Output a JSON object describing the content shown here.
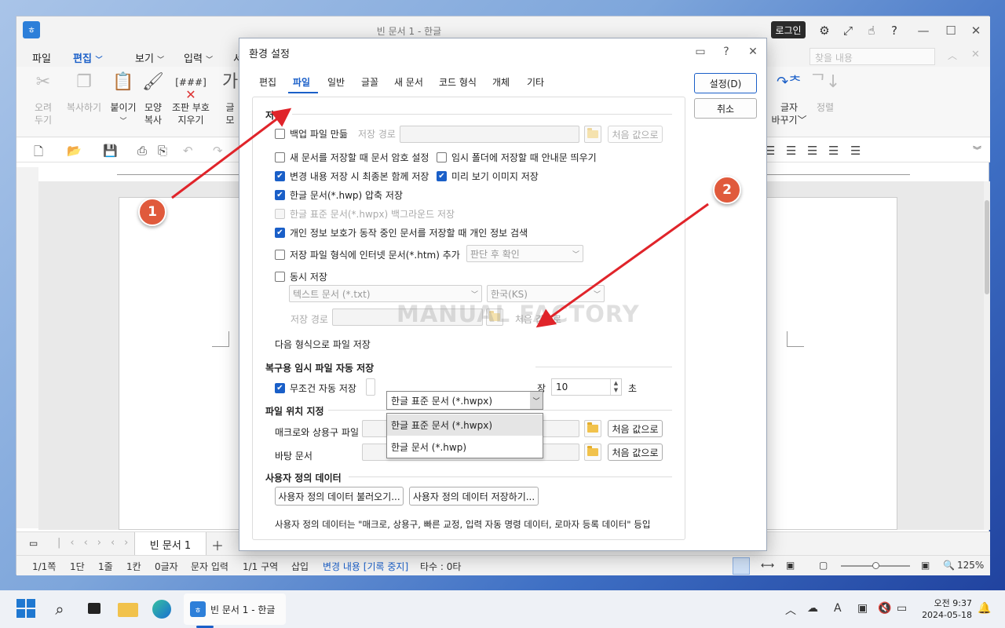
{
  "app": {
    "title": "빈 문서 1 - 한글",
    "login": "로그인",
    "icons": [
      "gear-icon",
      "expand-icon",
      "hand-icon",
      "help-icon"
    ],
    "window_controls": [
      "minimize-icon",
      "maximize-icon",
      "close-icon"
    ]
  },
  "menu": {
    "items": [
      "파일",
      "편집",
      "보기",
      "입력",
      "서"
    ],
    "active": "편집",
    "search_placeholder": "찾을 내용"
  },
  "ribbon": {
    "items": [
      {
        "label": "오려\n두기",
        "disabled": true
      },
      {
        "label": "복사하기",
        "disabled": true
      },
      {
        "label": "붙이기",
        "disabled": false
      },
      {
        "label": "모양\n복사",
        "disabled": false
      },
      {
        "label": "조판 부호\n지우기",
        "disabled": false
      },
      {
        "label": "글\n모",
        "disabled": false
      }
    ],
    "right_items": [
      {
        "label": "글자\n바꾸기",
        "disabled": false
      },
      {
        "label": "정렬",
        "disabled": true
      }
    ]
  },
  "document": {
    "tab": "빈 문서 1"
  },
  "status": {
    "items": [
      "1/1쪽",
      "1단",
      "1줄",
      "1칸",
      "0글자",
      "문자 입력",
      "1/1 구역",
      "삽입"
    ],
    "change_tracking": "변경 내용 [기록 중지]",
    "typing": "타수 : 0타",
    "zoom": "125%"
  },
  "dialog": {
    "title": "환경 설정",
    "tabs": [
      "편집",
      "파일",
      "일반",
      "글꼴",
      "새 문서",
      "코드 형식",
      "개체",
      "기타"
    ],
    "active_tab": "파일",
    "ok": "설정(D)",
    "cancel": "취소",
    "section_save": "저장",
    "backup": "백업 파일 만듦",
    "save_path_label": "저장 경로",
    "reset": "처음 값으로",
    "password_new": "새 문서를 저장할 때 문서 암호 설정",
    "temp_folder_notice": "임시 폴더에 저장할 때 안내문 띄우기",
    "keep_latest": "변경 내용 저장 시 최종본 함께 저장",
    "preview_image": "미리 보기 이미지 저장",
    "compress_hwp": "한글 문서(*.hwp) 압축 저장",
    "hwpx_background": "한글 표준 문서(*.hwpx) 백그라운드 저장",
    "privacy_search": "개인 정보 보호가 동작 중인 문서를 저장할 때 개인 정보 검색",
    "add_htm": "저장 파일 형식에 인터넷 문서(*.htm) 추가",
    "add_htm_option": "판단 후 확인",
    "simultaneous": "동시 저장",
    "simul_format": "텍스트 문서 (*.txt)",
    "simul_encoding": "한국(KS)",
    "simul_reset_partial": "처음 값으로",
    "save_as_label": "다음 형식으로 파일 저장",
    "save_as_value": "한글 표준 문서 (*.hwpx)",
    "save_as_options": [
      "한글 표준 문서 (*.hwpx)",
      "한글 문서 (*.hwp)"
    ],
    "section_autosave": "복구용 임시 파일 자동 저장",
    "autosave_always": "무조건 자동 저장",
    "autosave_partial_label": "장",
    "autosave_seconds": "10",
    "autosave_unit": "초",
    "section_location": "파일 위치 지정",
    "macro_label": "매크로와 상용구 파일",
    "background_label": "바탕 문서",
    "section_user": "사용자 정의 데이터",
    "load_user": "사용자 정의 데이터 불러오기...",
    "save_user": "사용자 정의 데이터 저장하기...",
    "user_note": "사용자 정의 데이터는 \"매크로, 상용구, 빠른 교정, 입력 자동 명령 데이터, 로마자 등록 데이터\" 등입"
  },
  "annotations": {
    "badge1": "1",
    "badge2": "2",
    "watermark": "MANUAL FACTORY",
    "arrow_color": "#e0242a"
  },
  "taskbar": {
    "app_label": "빈 문서 1 - 한글",
    "time": "오전 9:37",
    "date": "2024-05-18"
  }
}
